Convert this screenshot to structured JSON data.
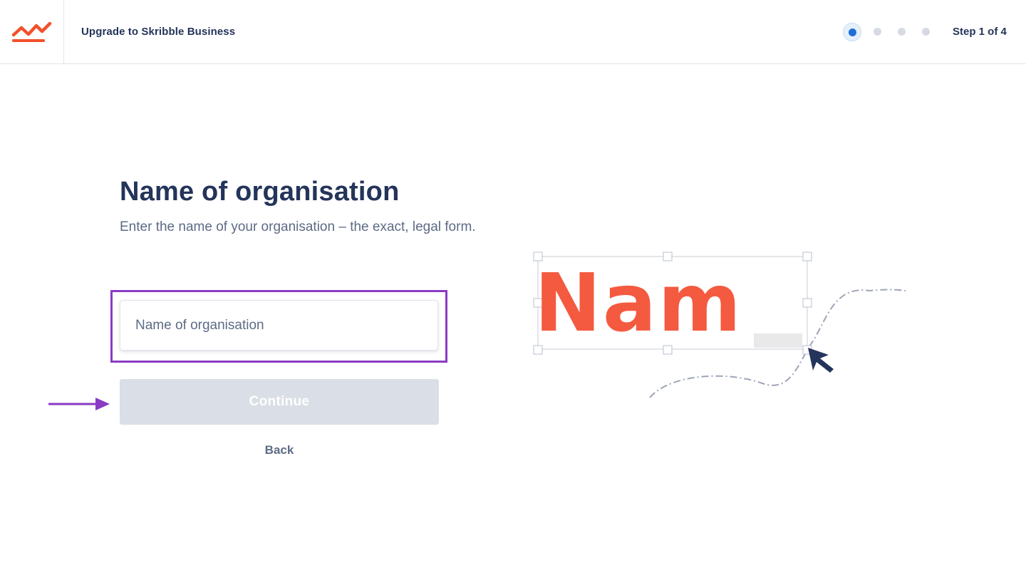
{
  "header": {
    "title": "Upgrade to Skribble Business",
    "step_label": "Step 1 of 4",
    "steps_total": 4,
    "current_step": 1
  },
  "main": {
    "title": "Name of organisation",
    "subtitle": "Enter the name of your organisation – the exact, legal form.",
    "org_input": {
      "value": "",
      "placeholder": "Name of organisation"
    },
    "continue_label": "Continue",
    "back_label": "Back"
  },
  "illustration": {
    "text": "Nam"
  },
  "colors": {
    "brand_orange": "#f2502b",
    "navy": "#24345a",
    "highlight_purple": "#8a3bc4",
    "step_active": "#1f6fd8",
    "button_disabled": "#dadee6"
  },
  "icons": {
    "logo": "skribble-logo-icon",
    "annotation_arrow": "arrow-right-icon",
    "cursor": "mouse-pointer-icon"
  }
}
